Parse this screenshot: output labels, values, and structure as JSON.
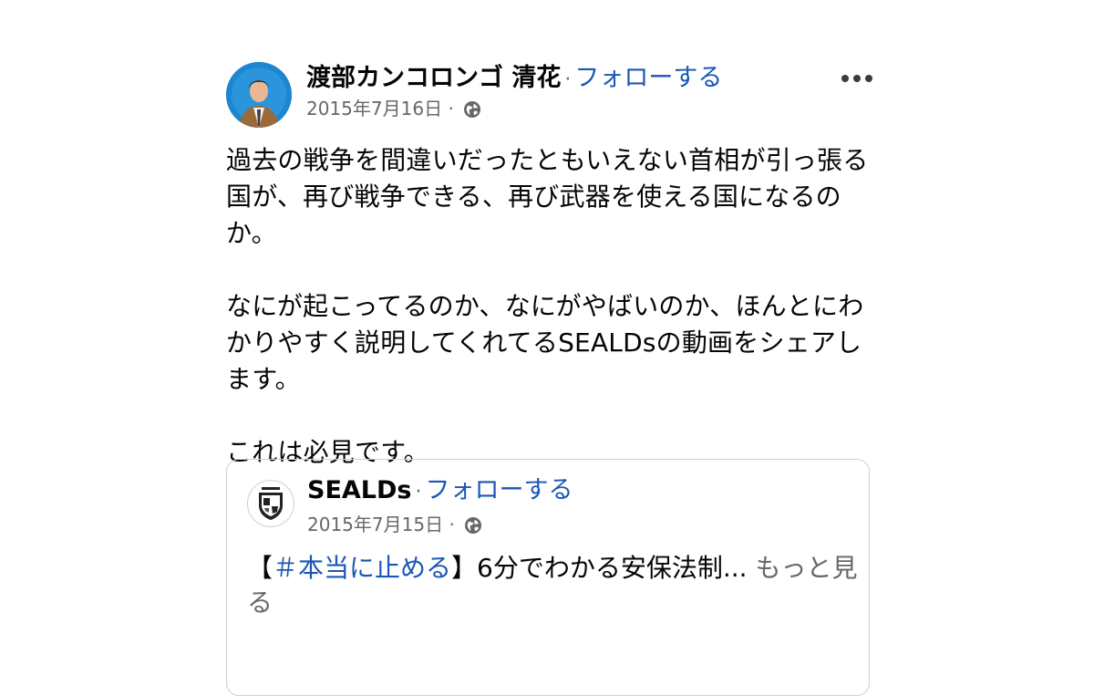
{
  "post": {
    "author": "渡部カンコロンゴ 清花",
    "separator": "·",
    "follow_label": "フォローする",
    "date": "2015年7月16日",
    "meta_separator": "·",
    "privacy_icon": "globe-icon",
    "more_icon": "more-options-icon",
    "paragraphs": [
      "過去の戦争を間違いだったともいえない首相が引っ張る国が、再び戦争できる、再び武器を使える国になるのか。",
      "なにが起こってるのか、なにがやばいのか、ほんとにわかりやすく説明してくれてるSEALDsの動画をシェアします。",
      "これは必見です。"
    ]
  },
  "shared_post": {
    "author": "SEALDs",
    "separator": "·",
    "follow_label": "フォローする",
    "date": "2015年7月15日",
    "meta_separator": "·",
    "bracket_open": "【",
    "hashtag": "＃本当に止める",
    "bracket_close": "】",
    "text": "6分でわかる安保法制...",
    "see_more": "もっと見る"
  },
  "colors": {
    "link": "#1a57b6",
    "secondary_text": "#65676b",
    "primary_text": "#050505",
    "border": "#ced0d4"
  }
}
